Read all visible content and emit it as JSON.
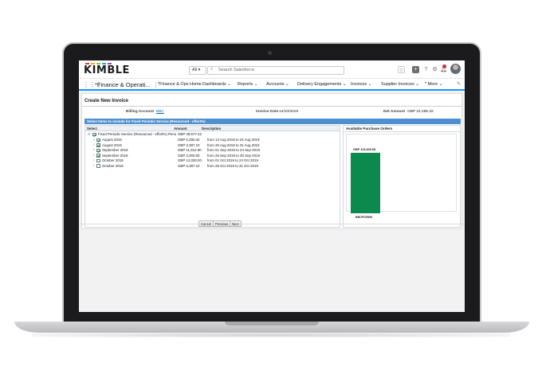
{
  "header": {
    "logo_text": "KIMBLE",
    "logo_colors": [
      "#e5393e",
      "#f6a623",
      "#8cc63f",
      "#29a3d9",
      "#8c4fb1"
    ],
    "search_scope": "All",
    "search_placeholder": "Search Salesforce"
  },
  "nav": {
    "app_name": "*Finance & Operati...",
    "items": [
      "*Finance & Ops Home",
      "Dashboards",
      "Reports",
      "Accounts",
      "Delivery Engagements",
      "Invoices",
      "Supplier Invoices",
      "* More"
    ]
  },
  "page": {
    "title": "Create New Invoice",
    "billing_account_label": "Billing Account",
    "billing_account_value": "BBC",
    "invoice_date_label": "Invoice Date",
    "invoice_date_value": "14/10/2019",
    "net_amount_label": "Net Amount",
    "net_amount_value": "GBP 24,286.32",
    "section_header": "Select Items to include for Fixed Periodic Service (Resourced - effort%)"
  },
  "grid": {
    "columns": [
      "Select",
      "Amount",
      "Description"
    ],
    "parent": {
      "label": "Fixed Periodic Service (Resourced - effort%) Period",
      "amount": "GBP 39,677.42",
      "checked": true
    },
    "rows": [
      {
        "label": "August 2019",
        "amount": "GBP 6,290.32",
        "description": "from 12 Aug 2019 to 24 Aug 2019",
        "checked": true
      },
      {
        "label": "August 2019",
        "amount": "GBP 3,387.10",
        "description": "from 26 Aug 2019 to 31 Aug 2019",
        "checked": true
      },
      {
        "label": "September 2019",
        "amount": "GBP 11,612.90",
        "description": "from 01 Sep 2019 to 24 Sep 2019",
        "checked": true
      },
      {
        "label": "September 2019",
        "amount": "GBP 3,000.00",
        "description": "from 25 Sep 2019 to 30 Sep 2019",
        "checked": true
      },
      {
        "label": "October 2019",
        "amount": "GBP 12,000.00",
        "description": "from 01 Oct 2019 to 24 Oct 2019",
        "checked": false
      },
      {
        "label": "October 2019",
        "amount": "GBP 3,387.10",
        "description": "from 25 Oct 2019 to 31 Oct 2019",
        "checked": false
      }
    ]
  },
  "purchase_orders": {
    "title": "Available Purchase Orders",
    "amount": "GBP 113,409.08",
    "name": "BBCPO9999",
    "bar_color": "#0c8a4e"
  },
  "buttons": {
    "cancel": "Cancel",
    "previous": "Previous",
    "next": "Next"
  }
}
